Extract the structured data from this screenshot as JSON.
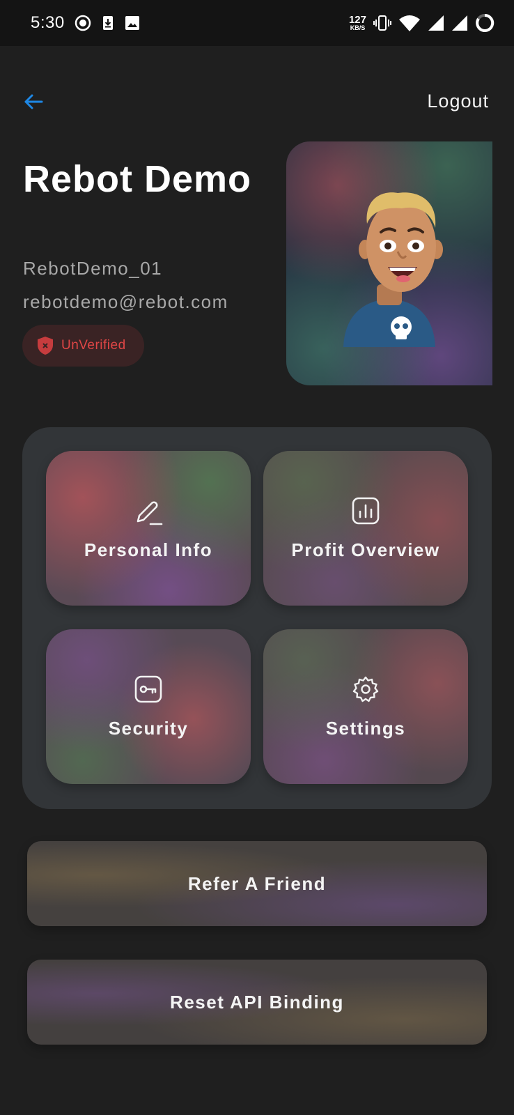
{
  "status_bar": {
    "time": "5:30",
    "net_speed_value": "127",
    "net_speed_unit": "KB/S",
    "left_icons": [
      "record-icon",
      "download-icon",
      "image-icon"
    ],
    "right_icons": [
      "vibrate-icon",
      "wifi-icon",
      "signal-icon",
      "signal-icon",
      "battery-ring-icon"
    ]
  },
  "header": {
    "back_icon": "arrow-left-icon",
    "logout_label": "Logout",
    "accent_color": "#1e88e5"
  },
  "profile": {
    "name": "Rebot Demo",
    "username": "RebotDemo_01",
    "email": "rebotdemo@rebot.com",
    "status_label": "UnVerified",
    "status_color": "#e04646",
    "status_icon": "shield-x-icon",
    "avatar_icon": "cartoon-avatar"
  },
  "menu": {
    "tiles": [
      {
        "label": "Personal Info",
        "icon": "pencil-icon"
      },
      {
        "label": "Profit Overview",
        "icon": "bar-chart-icon"
      },
      {
        "label": "Security",
        "icon": "key-icon"
      },
      {
        "label": "Settings",
        "icon": "gear-icon"
      }
    ]
  },
  "actions": {
    "refer_label": "Refer A Friend",
    "reset_label": "Reset API Binding"
  }
}
